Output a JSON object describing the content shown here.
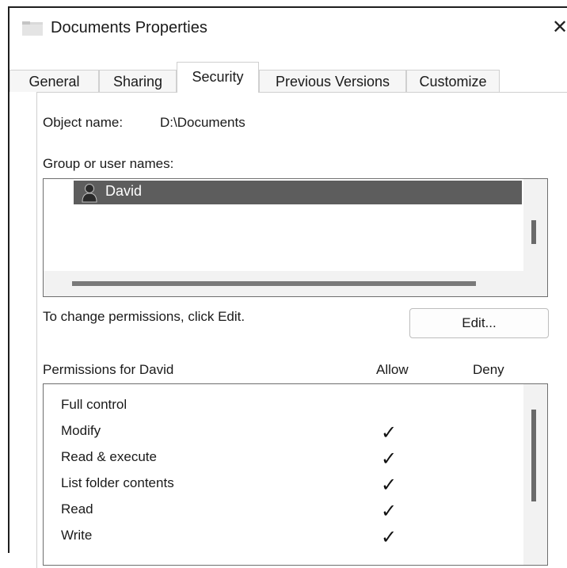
{
  "window": {
    "title": "Documents Properties",
    "close_glyph": "✕"
  },
  "tabs": [
    {
      "label": "General",
      "active": false
    },
    {
      "label": "Sharing",
      "active": false
    },
    {
      "label": "Security",
      "active": true
    },
    {
      "label": "Previous Versions",
      "active": false
    },
    {
      "label": "Customize",
      "active": false
    }
  ],
  "security": {
    "object_name_label": "Object name:",
    "object_name_value": "D:\\Documents",
    "group_label": "Group or user names:",
    "users": [
      {
        "name": "David",
        "selected": true,
        "icon": "user-icon"
      }
    ],
    "change_hint": "To change permissions, click Edit.",
    "edit_button": "Edit...",
    "permissions_label": "Permissions for David",
    "allow_header": "Allow",
    "deny_header": "Deny",
    "permissions": [
      {
        "name": "Full control",
        "allow": false,
        "deny": false
      },
      {
        "name": "Modify",
        "allow": true,
        "deny": false
      },
      {
        "name": "Read & execute",
        "allow": true,
        "deny": false
      },
      {
        "name": "List folder contents",
        "allow": true,
        "deny": false
      },
      {
        "name": "Read",
        "allow": true,
        "deny": false
      },
      {
        "name": "Write",
        "allow": true,
        "deny": false
      }
    ],
    "check_glyph": "✓"
  },
  "colors": {
    "selection": "#5d5d5d",
    "scroll_thumb": "#6a6a6a"
  }
}
